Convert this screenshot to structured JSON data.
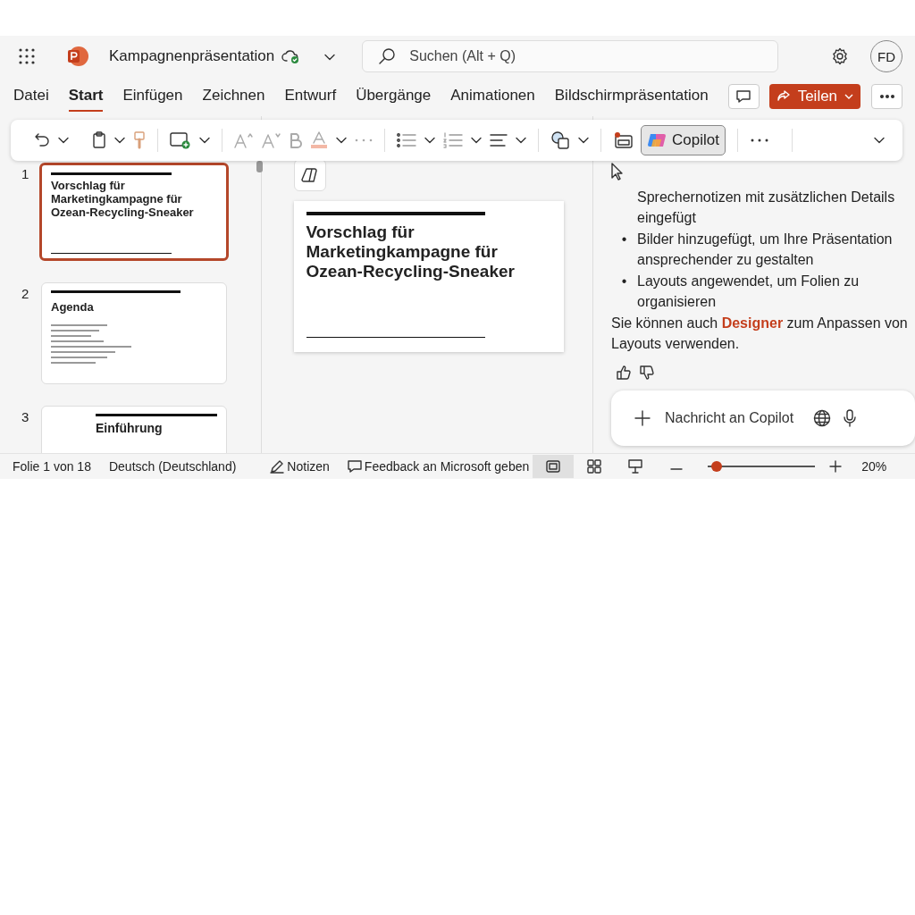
{
  "titlebar": {
    "file_name": "Kampagnenpräsentation",
    "search": {
      "placeholder": "Suchen (Alt + Q)"
    },
    "avatar": "FD"
  },
  "tabs": [
    {
      "label": "Datei",
      "selected": false
    },
    {
      "label": "Start",
      "selected": true
    },
    {
      "label": "Einfügen",
      "selected": false
    },
    {
      "label": "Zeichnen",
      "selected": false
    },
    {
      "label": "Entwurf",
      "selected": false
    },
    {
      "label": "Übergänge",
      "selected": false
    },
    {
      "label": "Animationen",
      "selected": false
    },
    {
      "label": "Bildschirmpräsentation",
      "selected": false
    }
  ],
  "share_button": "Teilen",
  "ribbon": {
    "copilot": {
      "label": "Copilot",
      "selected": true
    }
  },
  "slides": [
    {
      "number": "1",
      "kind": "title",
      "title": "Vorschlag für Marketingkampagne für Ozean-Recycling-Sneaker",
      "selected": true
    },
    {
      "number": "2",
      "kind": "agenda",
      "title": "Agenda",
      "selected": false
    },
    {
      "number": "3",
      "kind": "section",
      "title": "Einführung",
      "selected": false
    }
  ],
  "editor": {
    "slide_title": "Vorschlag für Marketingkampagne für Ozean-Recycling-Sneaker"
  },
  "copilot_pane": {
    "bullets": [
      {
        "text": "Sprechernotizen mit zusätzlichen Details eingefügt"
      },
      {
        "marker": "•",
        "text": "Bilder hinzugefügt, um Ihre Präsentation ansprechender zu gestalten"
      },
      {
        "marker": "•",
        "text": "Layouts angewendet, um Folien zu organisieren"
      }
    ],
    "message": "Sie können auch **Designer** zum Anpassen von Layouts verwenden.",
    "input": {
      "placeholder": "Nachricht an Copilot"
    }
  },
  "status_bar": {
    "slide_info": "Folie 1 von 18",
    "language": "Deutsch (Deutschland)",
    "notes": "Notizen",
    "feedback": "Feedback an Microsoft geben",
    "views": [
      {
        "kind": "normal",
        "selected": true
      },
      {
        "kind": "sorter",
        "selected": false
      },
      {
        "kind": "presenter",
        "selected": false
      }
    ],
    "zoom": {
      "level": 0.03,
      "reading": "20%"
    }
  }
}
